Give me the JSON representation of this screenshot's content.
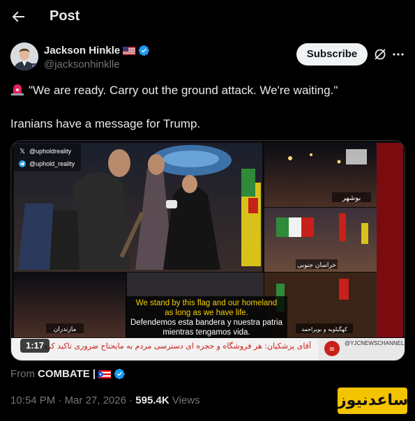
{
  "header": {
    "title": "Post"
  },
  "author": {
    "name": "Jackson Hinkle",
    "flag": "🇺🇸",
    "handle": "@jacksonhinklle",
    "avatar_badge": "HP"
  },
  "actions": {
    "subscribe_label": "Subscribe"
  },
  "tweet": {
    "line1": "\"We are ready. Carry out the ground attack. We're waiting.\"",
    "line2": "Iranians have a message for Trump."
  },
  "media": {
    "duration": "1:17",
    "watermark_x": "@upholdreality",
    "watermark_tg": "@uphold_reality",
    "caption_en_1": "We stand by this flag and our homeland",
    "caption_en_2": "as long as we have life.",
    "caption_es_1": "Defendemos esta bandera y nuestra patria",
    "caption_es_2": "mientras tengamos vida.",
    "channel_tag": "@YJCNEWSCHANNEL",
    "ticker": "آقای پزشکیان: هر فروشگاه و حجره ای      دسترسی مردم به مایحتاج ضروری تاکید کرد",
    "city_1": "بوشهر",
    "city_2": "خراسان جنوبی",
    "city_3": "مازندران",
    "city_4": "کهگیلویه و بویراحمد"
  },
  "from": {
    "prefix": "From",
    "name": "COMBATE |"
  },
  "meta": {
    "time": "10:54 PM",
    "separator": " · ",
    "date": "Mar 27, 2026",
    "views_count": "595.4K",
    "views_label": " Views"
  },
  "site_watermark": "ساعدنیوز",
  "colors": {
    "accent": "#1d9bf0",
    "background": "#000000",
    "muted": "#71767b",
    "text": "#e7e9ea"
  }
}
